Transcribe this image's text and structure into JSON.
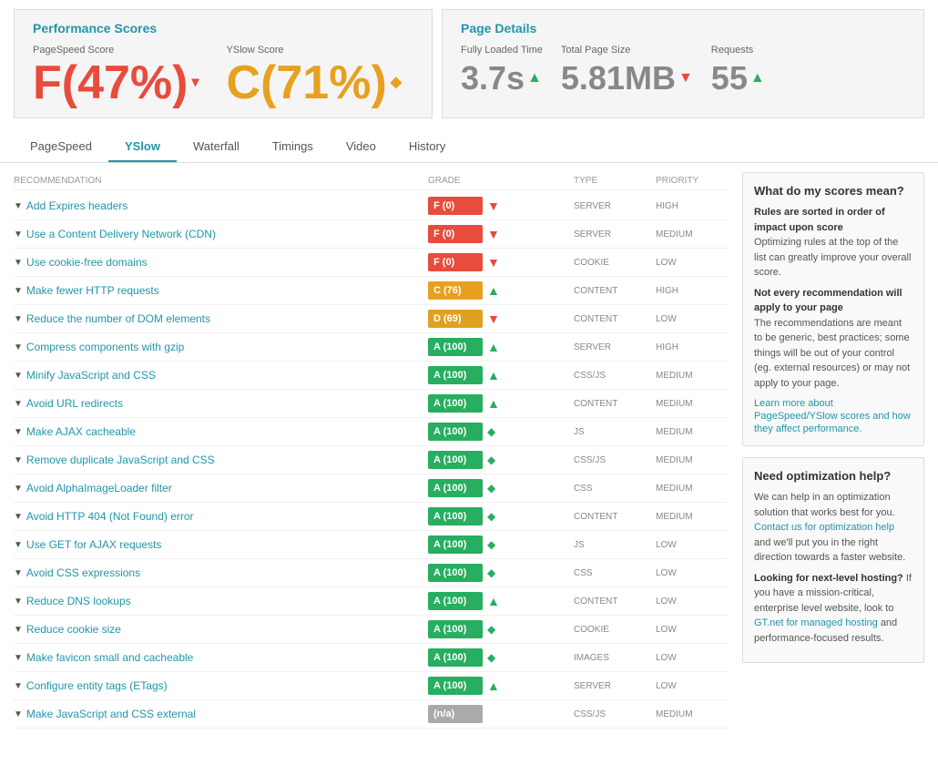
{
  "scores": {
    "title": "Performance Scores",
    "pagespeed": {
      "label": "PageSpeed Score",
      "value": "F(47%)",
      "arrow": "▾"
    },
    "yslow": {
      "label": "YSlow Score",
      "value": "C(71%)",
      "arrow": "◆"
    }
  },
  "details": {
    "title": "Page Details",
    "fully_loaded": {
      "label": "Fully Loaded Time",
      "value": "3.7s",
      "trend": "up"
    },
    "page_size": {
      "label": "Total Page Size",
      "value": "5.81MB",
      "trend": "down"
    },
    "requests": {
      "label": "Requests",
      "value": "55",
      "trend": "up"
    }
  },
  "tabs": [
    {
      "label": "PageSpeed",
      "active": false
    },
    {
      "label": "YSlow",
      "active": true
    },
    {
      "label": "Waterfall",
      "active": false
    },
    {
      "label": "Timings",
      "active": false
    },
    {
      "label": "Video",
      "active": false
    },
    {
      "label": "History",
      "active": false
    }
  ],
  "table": {
    "columns": [
      "RECOMMENDATION",
      "GRADE",
      "TYPE",
      "PRIORITY"
    ],
    "rows": [
      {
        "name": "Add Expires headers",
        "grade": "F (0)",
        "grade_type": "f",
        "icon": "down",
        "type": "SERVER",
        "priority": "HIGH"
      },
      {
        "name": "Use a Content Delivery Network (CDN)",
        "grade": "F (0)",
        "grade_type": "f",
        "icon": "down",
        "type": "SERVER",
        "priority": "MEDIUM"
      },
      {
        "name": "Use cookie-free domains",
        "grade": "F (0)",
        "grade_type": "f",
        "icon": "down",
        "type": "COOKIE",
        "priority": "LOW"
      },
      {
        "name": "Make fewer HTTP requests",
        "grade": "C (76)",
        "grade_type": "c",
        "icon": "up",
        "type": "CONTENT",
        "priority": "HIGH"
      },
      {
        "name": "Reduce the number of DOM elements",
        "grade": "D (69)",
        "grade_type": "d",
        "icon": "down",
        "type": "CONTENT",
        "priority": "LOW"
      },
      {
        "name": "Compress components with gzip",
        "grade": "A (100)",
        "grade_type": "a",
        "icon": "up",
        "type": "SERVER",
        "priority": "HIGH"
      },
      {
        "name": "Minify JavaScript and CSS",
        "grade": "A (100)",
        "grade_type": "a",
        "icon": "up",
        "type": "CSS/JS",
        "priority": "MEDIUM"
      },
      {
        "name": "Avoid URL redirects",
        "grade": "A (100)",
        "grade_type": "a",
        "icon": "up",
        "type": "CONTENT",
        "priority": "MEDIUM"
      },
      {
        "name": "Make AJAX cacheable",
        "grade": "A (100)",
        "grade_type": "a",
        "icon": "diamond",
        "type": "JS",
        "priority": "MEDIUM"
      },
      {
        "name": "Remove duplicate JavaScript and CSS",
        "grade": "A (100)",
        "grade_type": "a",
        "icon": "diamond",
        "type": "CSS/JS",
        "priority": "MEDIUM"
      },
      {
        "name": "Avoid AlphaImageLoader filter",
        "grade": "A (100)",
        "grade_type": "a",
        "icon": "diamond",
        "type": "CSS",
        "priority": "MEDIUM"
      },
      {
        "name": "Avoid HTTP 404 (Not Found) error",
        "grade": "A (100)",
        "grade_type": "a",
        "icon": "diamond",
        "type": "CONTENT",
        "priority": "MEDIUM"
      },
      {
        "name": "Use GET for AJAX requests",
        "grade": "A (100)",
        "grade_type": "a",
        "icon": "diamond",
        "type": "JS",
        "priority": "LOW"
      },
      {
        "name": "Avoid CSS expressions",
        "grade": "A (100)",
        "grade_type": "a",
        "icon": "diamond",
        "type": "CSS",
        "priority": "LOW"
      },
      {
        "name": "Reduce DNS lookups",
        "grade": "A (100)",
        "grade_type": "a",
        "icon": "up",
        "type": "CONTENT",
        "priority": "LOW"
      },
      {
        "name": "Reduce cookie size",
        "grade": "A (100)",
        "grade_type": "a",
        "icon": "diamond",
        "type": "COOKIE",
        "priority": "LOW"
      },
      {
        "name": "Make favicon small and cacheable",
        "grade": "A (100)",
        "grade_type": "a",
        "icon": "diamond",
        "type": "IMAGES",
        "priority": "LOW"
      },
      {
        "name": "Configure entity tags (ETags)",
        "grade": "A (100)",
        "grade_type": "a",
        "icon": "up",
        "type": "SERVER",
        "priority": "LOW"
      },
      {
        "name": "Make JavaScript and CSS external",
        "grade": "(n/a)",
        "grade_type": "na",
        "icon": "none",
        "type": "CSS/JS",
        "priority": "MEDIUM"
      }
    ]
  },
  "sidebar": {
    "scores_box": {
      "title": "What do my scores mean?",
      "p1_bold": "Rules are sorted in order of impact upon score",
      "p1": "Optimizing rules at the top of the list can greatly improve your overall score.",
      "p2_bold": "Not every recommendation will apply to your page",
      "p2": "The recommendations are meant to be generic, best practices; some things will be out of your control (eg. external resources) or may not apply to your page.",
      "link": "Learn more about PageSpeed/YSlow scores and how they affect performance."
    },
    "help_box": {
      "title": "Need optimization help?",
      "p1": "We can help in an optimization solution that works best for you.",
      "link1": "Contact us for optimization help",
      "p1_rest": " and we'll put you in the right direction towards a faster website.",
      "p2_bold": "Looking for next-level hosting?",
      "p2": " If you have a mission-critical, enterprise level website, look to ",
      "link2": "GT.net for managed hosting",
      "p2_rest": " and performance-focused results."
    }
  }
}
